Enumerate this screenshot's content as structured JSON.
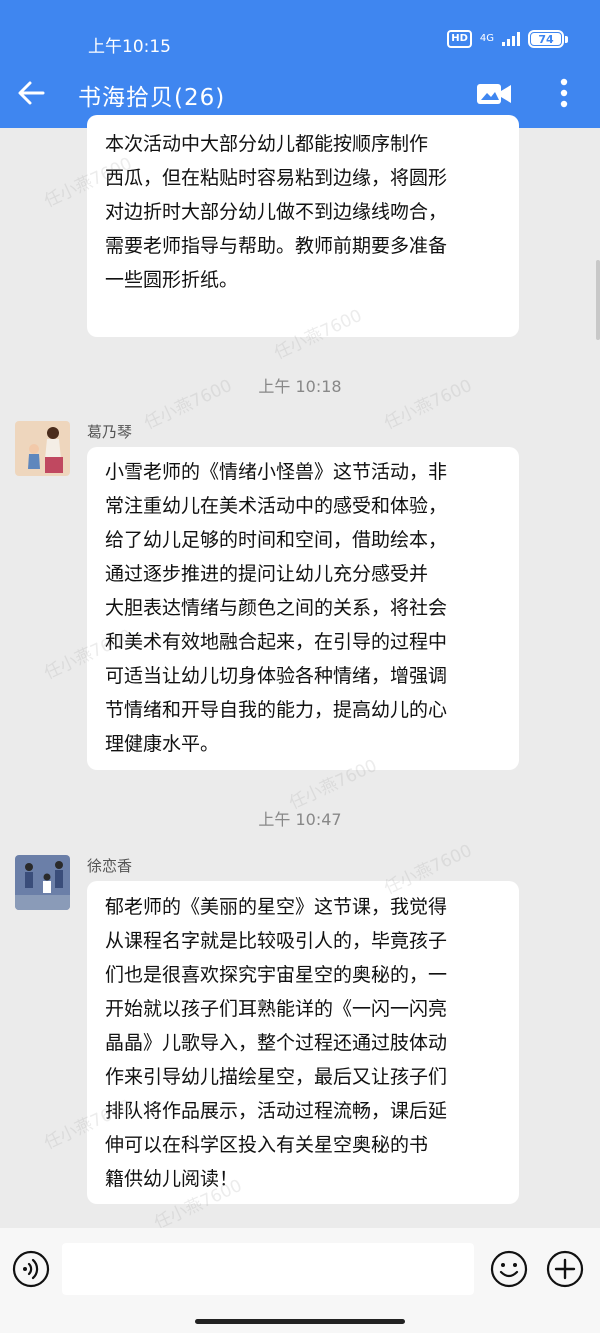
{
  "status": {
    "time": "上午10:15",
    "hd": "HD",
    "network": "4G",
    "battery": "74"
  },
  "header": {
    "title": "书海拾贝(26)"
  },
  "watermark": "任小燕7600",
  "messages": [
    {
      "text": "本次活动中大部分幼儿都能按顺序制作西瓜，但在粘贴时容易粘到边缘，将圆形对边折时大部分幼儿做不到边缘线吻合，需要老师指导与帮助。教师前期要多准备一些圆形折纸。"
    },
    {
      "time": "上午 10:18",
      "sender": "葛乃琴",
      "text": "小雪老师的《情绪小怪兽》这节活动，非常注重幼儿在美术活动中的感受和体验，给了幼儿足够的时间和空间，借助绘本，通过逐步推进的提问让幼儿充分感受并大胆表达情绪与颜色之间的关系，将社会和美术有效地融合起来，在引导的过程中可适当让幼儿切身体验各种情绪，增强调节情绪和开导自我的能力，提高幼儿的心理健康水平。"
    },
    {
      "time": "上午 10:47",
      "sender": "徐恋香",
      "text": "郁老师的《美丽的星空》这节课，我觉得从课程名字就是比较吸引人的，毕竟孩子们也是很喜欢探究宇宙星空的奥秘的，一开始就以孩子们耳熟能详的《一闪一闪亮晶晶》儿歌导入，整个过程还通过肢体动作来引导幼儿描绘星空，最后又让孩子们排队将作品展示，活动过程流畅，课后延伸可以在科学区投入有关星空奥秘的书籍供幼儿阅读！"
    }
  ],
  "lines": {
    "m0": [
      "本次活动中大部分幼儿都能按顺序制作",
      "西瓜，但在粘贴时容易粘到边缘，将圆形",
      "对边折时大部分幼儿做不到边缘线吻合，",
      "需要老师指导与帮助。教师前期要多准备",
      "一些圆形折纸。"
    ],
    "m1": [
      "小雪老师的《情绪小怪兽》这节活动，非",
      "常注重幼儿在美术活动中的感受和体验，",
      "给了幼儿足够的时间和空间，借助绘本，",
      "通过逐步推进的提问让幼儿充分感受并",
      "大胆表达情绪与颜色之间的关系，将社会",
      "和美术有效地融合起来，在引导的过程中",
      "可适当让幼儿切身体验各种情绪，增强调",
      "节情绪和开导自我的能力，提高幼儿的心",
      "理健康水平。"
    ],
    "m2": [
      "郁老师的《美丽的星空》这节课，我觉得",
      "从课程名字就是比较吸引人的，毕竟孩子",
      "们也是很喜欢探究宇宙星空的奥秘的，一",
      "开始就以孩子们耳熟能详的《一闪一闪亮",
      "晶晶》儿歌导入，整个过程还通过肢体动",
      "作来引导幼儿描绘星空，最后又让孩子们",
      "排队将作品展示，活动过程流畅，课后延",
      "伸可以在科学区投入有关星空奥秘的书",
      "籍供幼儿阅读！"
    ]
  },
  "icons": [
    "back-arrow-icon",
    "video-call-icon",
    "more-vertical-icon",
    "voice-icon",
    "emoji-icon",
    "plus-icon"
  ],
  "colors": {
    "header": "#3f86f0",
    "background": "#ebebeb",
    "bubble": "#ffffff"
  }
}
